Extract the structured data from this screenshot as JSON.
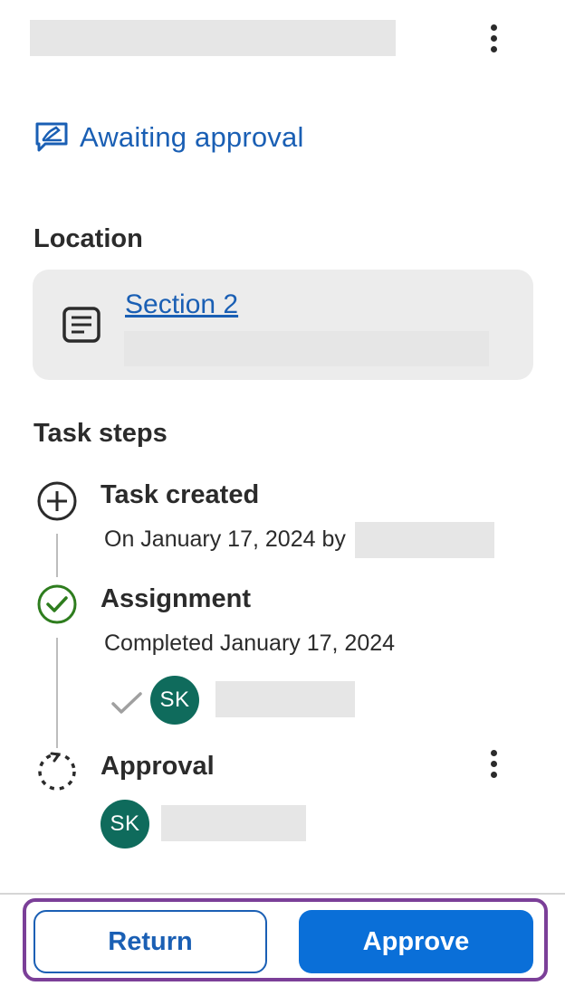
{
  "status": {
    "label": "Awaiting approval",
    "icon": "signature-icon"
  },
  "location": {
    "heading": "Location",
    "item_label": "Section 2",
    "item_icon": "document-icon"
  },
  "task_steps": {
    "heading": "Task steps",
    "steps": [
      {
        "title": "Task created",
        "meta": "On January 17, 2024 by",
        "icon": "plus-circle-icon"
      },
      {
        "title": "Assignment",
        "meta": "Completed January 17, 2024",
        "icon": "check-circle-icon",
        "assignee_initials": "SK"
      },
      {
        "title": "Approval",
        "icon": "pending-circle-icon",
        "assignee_initials": "SK"
      }
    ]
  },
  "actions": {
    "return_label": "Return",
    "approve_label": "Approve"
  },
  "colors": {
    "link": "#1a5fb4",
    "primary": "#0a6fd8",
    "avatar": "#0f6b5c",
    "complete": "#2e7d1e",
    "focus_outline": "#7b3f98"
  }
}
